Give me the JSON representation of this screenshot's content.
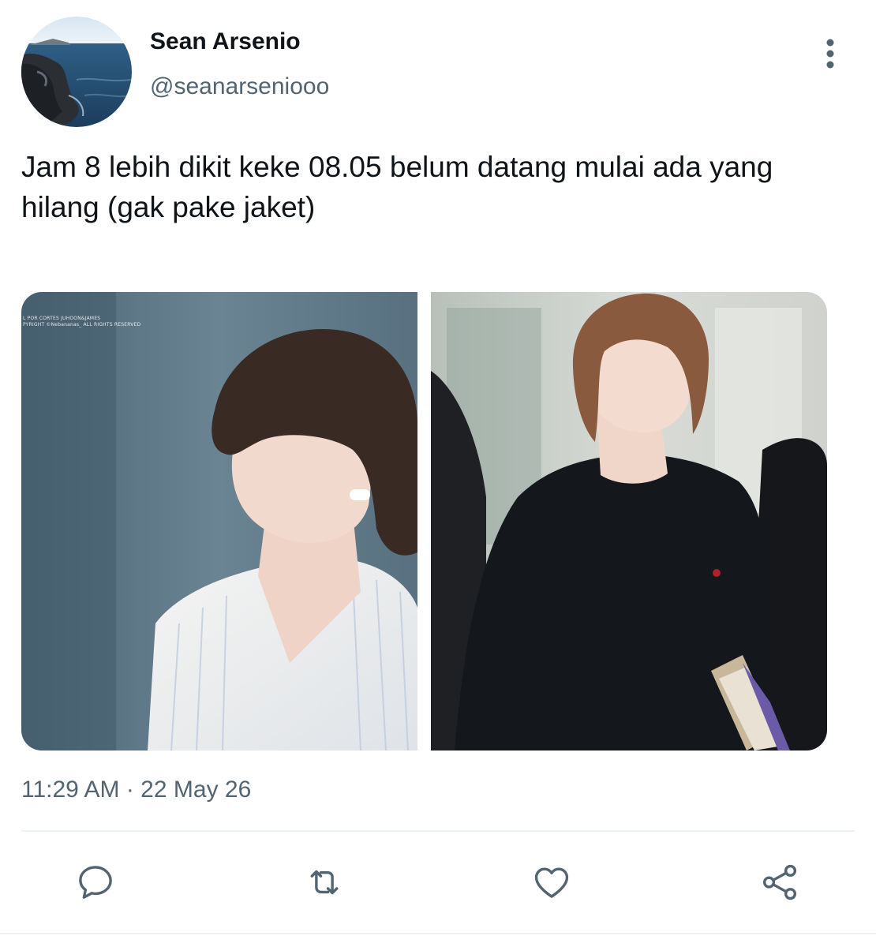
{
  "author": {
    "display_name": "Sean Arsenio",
    "handle": "@seanarseniooo",
    "avatar_icon": "seascape-avatar"
  },
  "tweet": {
    "text": "Jam 8 lebih dikit keke 08.05 belum datang mulai ada yang hilang (gak pake jaket)",
    "timestamp": "11:29 AM · 22 May 26"
  },
  "media": {
    "photos": [
      {
        "description_icon": "photo-white-shirt",
        "watermark_line1": "L POR CORTES JUHOON&JAMES",
        "watermark_line2": "PYRIGHT ©Nebananas_ ALL RIGHTS RESERVED"
      },
      {
        "description_icon": "photo-black-sweater"
      }
    ]
  },
  "actions": {
    "reply_icon": "reply-icon",
    "retweet_icon": "retweet-icon",
    "like_icon": "heart-icon",
    "share_icon": "share-icon",
    "more_icon": "more-vertical-icon"
  },
  "colors": {
    "text_primary": "#0f1419",
    "text_secondary": "#536471",
    "icon": "#536471",
    "divider": "#eff3f4"
  }
}
